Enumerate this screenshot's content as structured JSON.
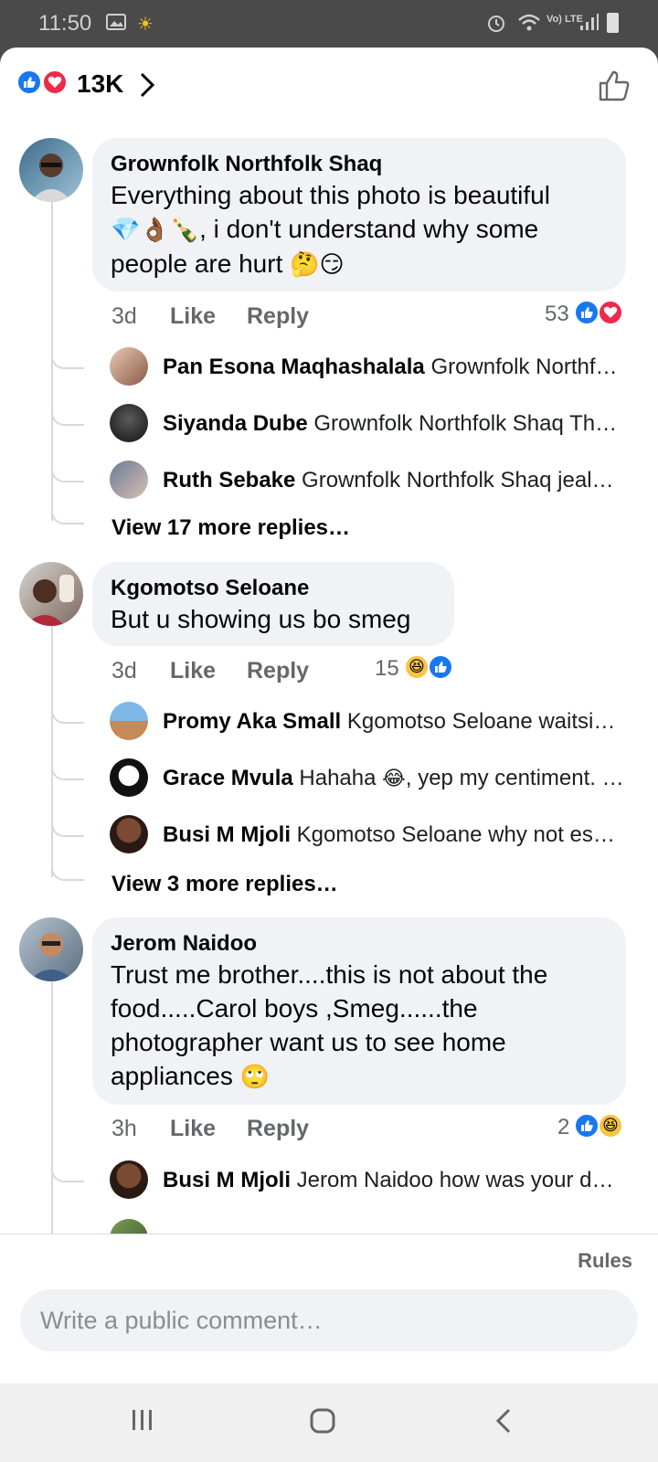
{
  "status_bar": {
    "time": "11:50",
    "network": "Vo) LTE"
  },
  "header": {
    "reaction_count": "13K"
  },
  "comments": [
    {
      "author": "Grownfolk Northfolk Shaq",
      "text_lines": [
        "Everything about this photo is beautiful",
        ", i don't understand why some",
        "people are hurt"
      ],
      "age": "3d",
      "like_label": "Like",
      "reply_label": "Reply",
      "reaction_count": "53",
      "replies": [
        {
          "name": "Pan Esona Maqhashalala",
          "text": "Grownfolk Northf…"
        },
        {
          "name": "Siyanda Dube",
          "text": "Grownfolk Northfolk Shaq Th…"
        },
        {
          "name": "Ruth Sebake",
          "text": "Grownfolk Northfolk Shaq jeal…"
        }
      ],
      "more_replies": "View 17 more replies…"
    },
    {
      "author": "Kgomotso Seloane",
      "text_lines": [
        "But u showing us bo smeg"
      ],
      "age": "3d",
      "like_label": "Like",
      "reply_label": "Reply",
      "reaction_count": "15",
      "replies": [
        {
          "name": "Promy Aka Small",
          "text": "Kgomotso Seloane waitsi…"
        },
        {
          "name": "Grace Mvula",
          "text_before": "Hahaha",
          "text_after": ", yep my centiment. …"
        },
        {
          "name": "Busi M Mjoli",
          "text": "Kgomotso Seloane why not es…"
        }
      ],
      "more_replies": "View 3 more replies…"
    },
    {
      "author": "Jerom Naidoo",
      "text_lines": [
        "Trust me brother....this is not about the",
        "food.....Carol boys ,Smeg......the",
        "photographer want us to see home",
        "appliances"
      ],
      "age": "3h",
      "like_label": "Like",
      "reply_label": "Reply",
      "reaction_count": "2",
      "replies": [
        {
          "name": "Busi M Mjoli",
          "text": "Jerom Naidoo how was your d…"
        }
      ]
    }
  ],
  "composer": {
    "rules_label": "Rules",
    "placeholder": "Write a public comment…"
  },
  "colors": {
    "like_blue": "#1877f2",
    "love_red": "#f02849",
    "bubble_gray": "#f0f2f5",
    "meta_gray": "#65676b"
  },
  "icons": [
    "image-icon",
    "sun-icon",
    "alarm-icon",
    "wifi-icon",
    "signal-icon",
    "battery-icon",
    "like-reaction-icon",
    "love-reaction-icon",
    "haha-reaction-icon",
    "chevron-right-icon",
    "thumbs-up-icon",
    "recents-icon",
    "home-icon",
    "back-icon"
  ]
}
